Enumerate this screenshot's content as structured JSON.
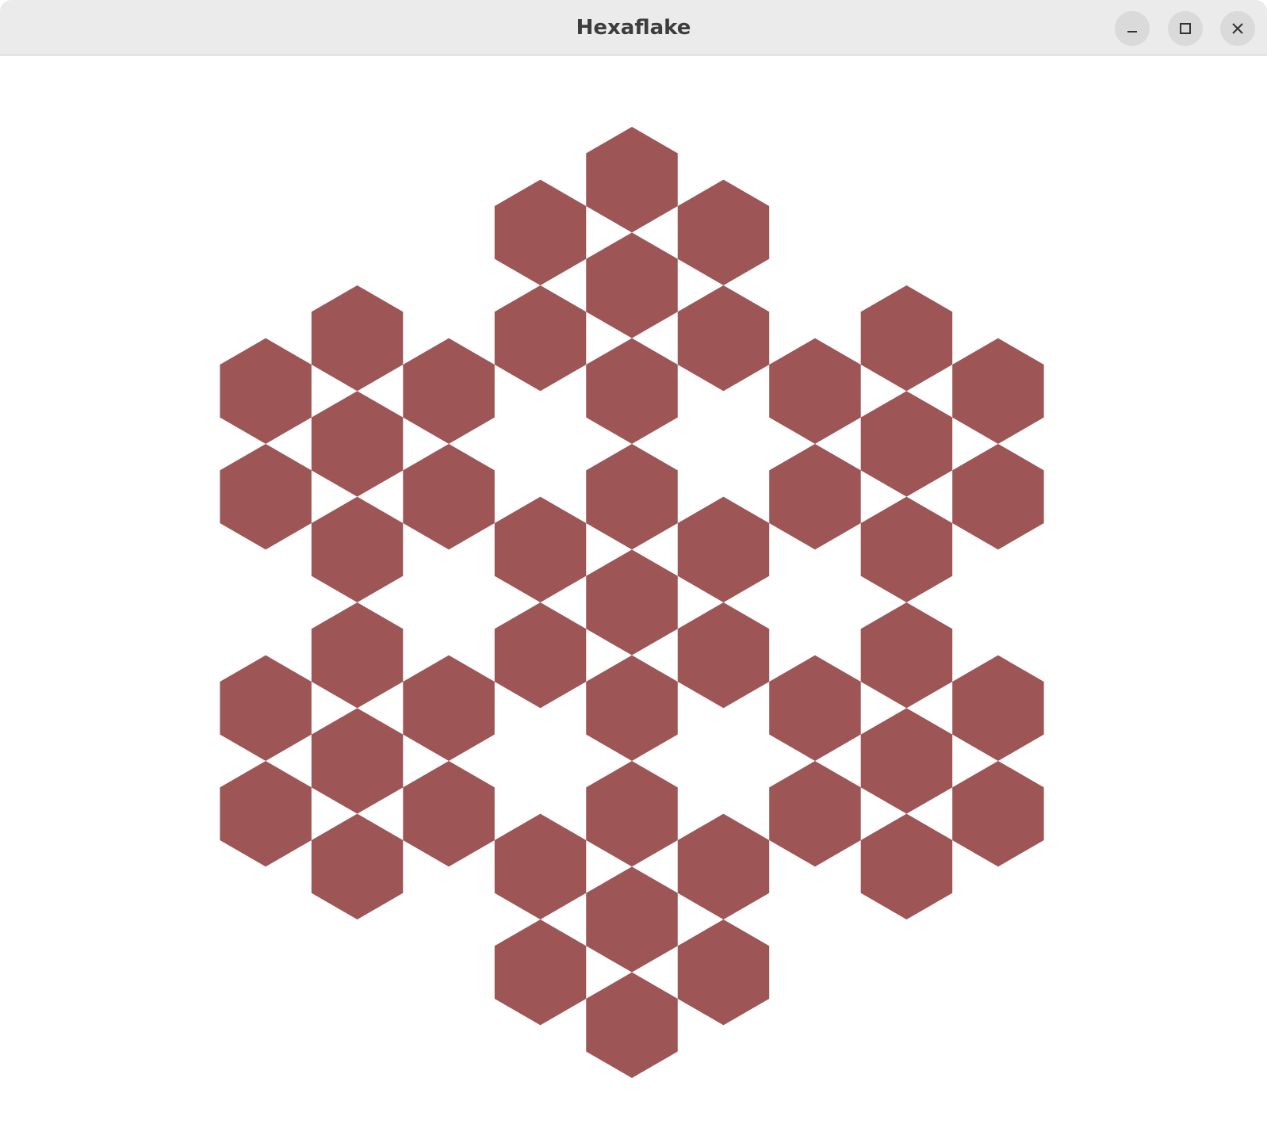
{
  "window": {
    "title": "Hexaflake"
  },
  "controls": {
    "minimize_icon": "minimize-icon",
    "maximize_icon": "maximize-icon",
    "close_icon": "close-icon"
  },
  "fractal": {
    "name": "hexaflake",
    "depth": 2,
    "fill_color": "#9e5555",
    "background_color": "#ffffff"
  }
}
